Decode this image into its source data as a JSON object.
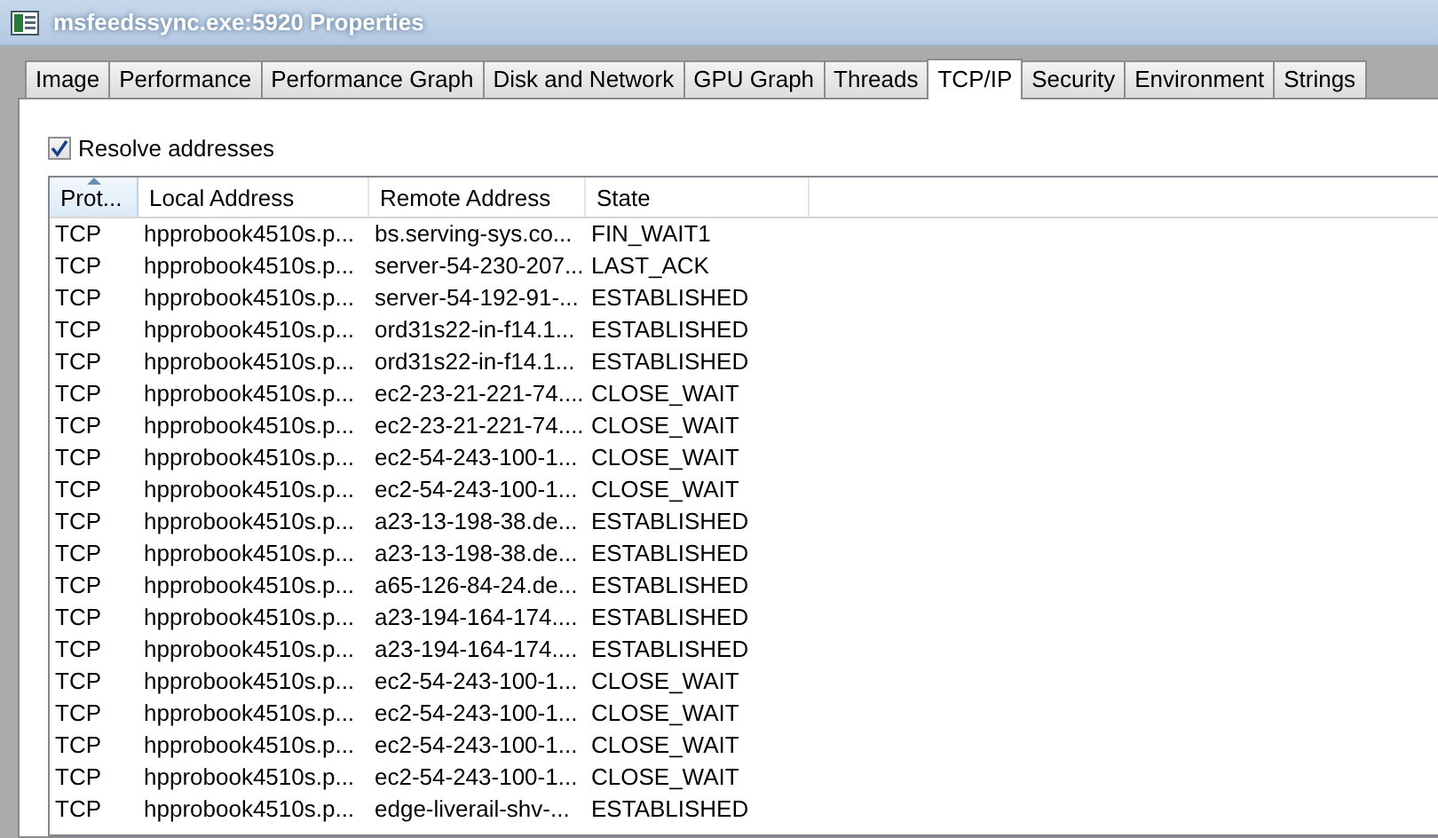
{
  "window": {
    "title": "msfeedssync.exe:5920 Properties"
  },
  "tabs": [
    {
      "label": "Image",
      "selected": false
    },
    {
      "label": "Performance",
      "selected": false
    },
    {
      "label": "Performance Graph",
      "selected": false
    },
    {
      "label": "Disk and Network",
      "selected": false
    },
    {
      "label": "GPU Graph",
      "selected": false
    },
    {
      "label": "Threads",
      "selected": false
    },
    {
      "label": "TCP/IP",
      "selected": true
    },
    {
      "label": "Security",
      "selected": false
    },
    {
      "label": "Environment",
      "selected": false
    },
    {
      "label": "Strings",
      "selected": false
    }
  ],
  "resolve_addresses": {
    "label": "Resolve addresses",
    "checked": true
  },
  "table": {
    "columns": [
      {
        "label": "Prot...",
        "sorted": true
      },
      {
        "label": "Local Address",
        "sorted": false
      },
      {
        "label": "Remote Address",
        "sorted": false
      },
      {
        "label": "State",
        "sorted": false
      }
    ],
    "rows": [
      [
        "TCP",
        "hpprobook4510s.p...",
        "bs.serving-sys.co...",
        "FIN_WAIT1"
      ],
      [
        "TCP",
        "hpprobook4510s.p...",
        "server-54-230-207...",
        "LAST_ACK"
      ],
      [
        "TCP",
        "hpprobook4510s.p...",
        "server-54-192-91-...",
        "ESTABLISHED"
      ],
      [
        "TCP",
        "hpprobook4510s.p...",
        "ord31s22-in-f14.1...",
        "ESTABLISHED"
      ],
      [
        "TCP",
        "hpprobook4510s.p...",
        "ord31s22-in-f14.1...",
        "ESTABLISHED"
      ],
      [
        "TCP",
        "hpprobook4510s.p...",
        "ec2-23-21-221-74....",
        "CLOSE_WAIT"
      ],
      [
        "TCP",
        "hpprobook4510s.p...",
        "ec2-23-21-221-74....",
        "CLOSE_WAIT"
      ],
      [
        "TCP",
        "hpprobook4510s.p...",
        "ec2-54-243-100-1...",
        "CLOSE_WAIT"
      ],
      [
        "TCP",
        "hpprobook4510s.p...",
        "ec2-54-243-100-1...",
        "CLOSE_WAIT"
      ],
      [
        "TCP",
        "hpprobook4510s.p...",
        "a23-13-198-38.de...",
        "ESTABLISHED"
      ],
      [
        "TCP",
        "hpprobook4510s.p...",
        "a23-13-198-38.de...",
        "ESTABLISHED"
      ],
      [
        "TCP",
        "hpprobook4510s.p...",
        "a65-126-84-24.de...",
        "ESTABLISHED"
      ],
      [
        "TCP",
        "hpprobook4510s.p...",
        "a23-194-164-174....",
        "ESTABLISHED"
      ],
      [
        "TCP",
        "hpprobook4510s.p...",
        "a23-194-164-174....",
        "ESTABLISHED"
      ],
      [
        "TCP",
        "hpprobook4510s.p...",
        "ec2-54-243-100-1...",
        "CLOSE_WAIT"
      ],
      [
        "TCP",
        "hpprobook4510s.p...",
        "ec2-54-243-100-1...",
        "CLOSE_WAIT"
      ],
      [
        "TCP",
        "hpprobook4510s.p...",
        "ec2-54-243-100-1...",
        "CLOSE_WAIT"
      ],
      [
        "TCP",
        "hpprobook4510s.p...",
        "ec2-54-243-100-1...",
        "CLOSE_WAIT"
      ],
      [
        "TCP",
        "hpprobook4510s.p...",
        "edge-liverail-shv-...",
        "ESTABLISHED"
      ]
    ]
  }
}
